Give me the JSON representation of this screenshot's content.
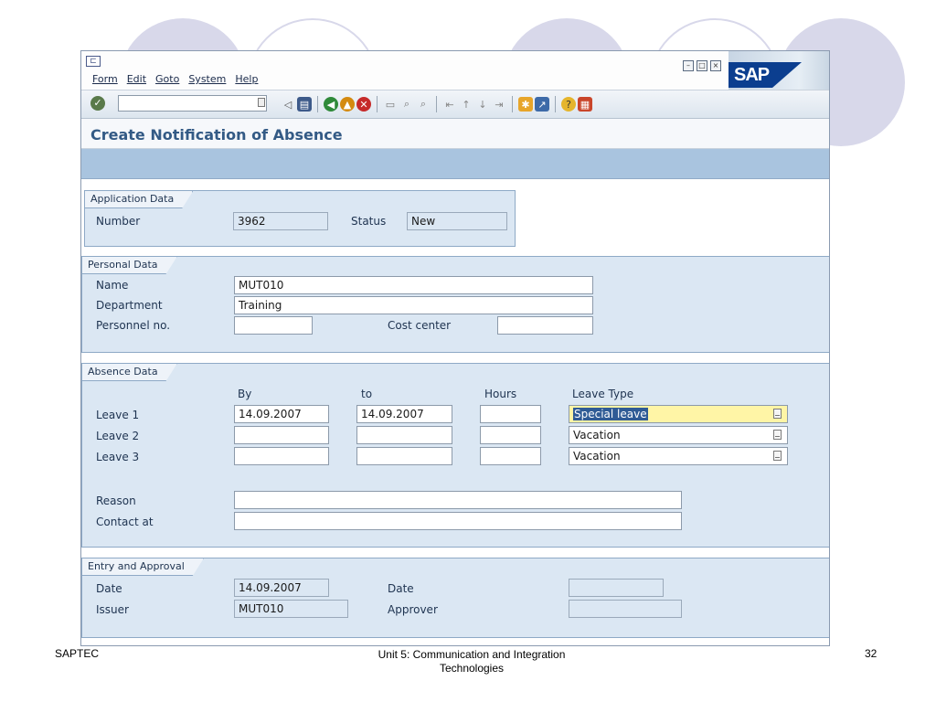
{
  "menu": {
    "items": [
      "Form",
      "Edit",
      "Goto",
      "System",
      "Help"
    ]
  },
  "logo": {
    "text": "SAP"
  },
  "toolbar": {
    "command_value": "",
    "icons": [
      "enter-icon",
      "back-icon",
      "save-icon",
      "back-arrow-icon",
      "exit-icon",
      "cancel-icon",
      "print-icon",
      "find-icon",
      "find-next-icon",
      "first-page-icon",
      "previous-page-icon",
      "next-page-icon",
      "last-page-icon",
      "create-session-icon",
      "shortcut-icon",
      "help-icon",
      "layout-icon"
    ]
  },
  "title": "Create Notification of Absence",
  "application_data": {
    "title": "Application Data",
    "number_label": "Number",
    "number_value": "3962",
    "status_label": "Status",
    "status_value": "New"
  },
  "personal_data": {
    "title": "Personal Data",
    "name_label": "Name",
    "name_value": "MUT010",
    "department_label": "Department",
    "department_value": "Training",
    "personnel_label": "Personnel no.",
    "personnel_value": "",
    "cost_center_label": "Cost center",
    "cost_center_value": ""
  },
  "absence_data": {
    "title": "Absence Data",
    "col_by": "By",
    "col_to": "to",
    "col_hours": "Hours",
    "col_leave_type": "Leave Type",
    "rows": [
      {
        "label": "Leave 1",
        "by": "14.09.2007",
        "to": "14.09.2007",
        "hours": "",
        "leave_type": "Special leave"
      },
      {
        "label": "Leave 2",
        "by": "",
        "to": "",
        "hours": "",
        "leave_type": "Vacation"
      },
      {
        "label": "Leave 3",
        "by": "",
        "to": "",
        "hours": "",
        "leave_type": "Vacation"
      }
    ],
    "reason_label": "Reason",
    "reason_value": "",
    "contact_label": "Contact at",
    "contact_value": ""
  },
  "entry_approval": {
    "title": "Entry and Approval",
    "date_label": "Date",
    "date_value": "14.09.2007",
    "issuer_label": "Issuer",
    "issuer_value": "MUT010",
    "approval_date_label": "Date",
    "approval_date_value": "",
    "approver_label": "Approver",
    "approver_value": ""
  },
  "footer": {
    "left": "SAPTEC",
    "center_line1": "Unit 5: Communication and Integration",
    "center_line2": "Technologies",
    "page_number": "32"
  },
  "colors": {
    "accent": "#335a85",
    "panel": "#dbe7f3",
    "highlight_field": "#fff5a6",
    "selection": "#2f5b95"
  }
}
